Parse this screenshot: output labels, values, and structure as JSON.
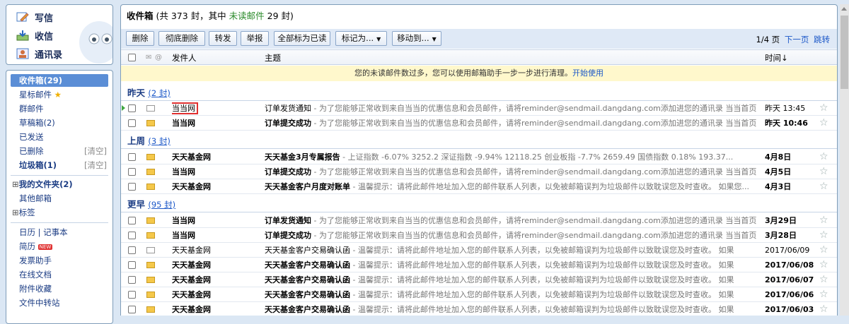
{
  "quick_actions": {
    "compose": "写信",
    "receive": "收信",
    "contacts": "通讯录"
  },
  "folders": [
    {
      "label": "收件箱(29)",
      "selected": true
    },
    {
      "label": "星标邮件",
      "star": true
    },
    {
      "label": "群邮件"
    },
    {
      "label": "草稿箱(2)"
    },
    {
      "label": "已发送"
    },
    {
      "label": "已删除",
      "clear": "[清空]"
    },
    {
      "label": "垃圾箱(1)",
      "clear": "[清空]",
      "bold": true
    },
    {
      "label": "我的文件夹(2)",
      "group": true,
      "bold": true
    },
    {
      "label": "其他邮箱"
    },
    {
      "label": "标签",
      "group": true
    },
    {
      "label": "日历 | 记事本"
    },
    {
      "label": "简历",
      "badge": "NEW"
    },
    {
      "label": "发票助手"
    },
    {
      "label": "在线文档"
    },
    {
      "label": "附件收藏"
    },
    {
      "label": "文件中转站"
    }
  ],
  "header": {
    "title": "收件箱",
    "count_text": " (共 373 封，其中 ",
    "unread_text": "未读邮件",
    "unread_count": " 29 封)"
  },
  "toolbar": {
    "buttons": [
      "删除",
      "彻底删除",
      "转发",
      "举报",
      "全部标为已读",
      "标记为...",
      "移动到..."
    ],
    "pager": "1/4 页",
    "next": "下一页",
    "jump": "跳转"
  },
  "columns": {
    "from": "发件人",
    "subject": "主题",
    "time": "时间↓"
  },
  "notice": {
    "text": "您的未读邮件数过多，您可以使用邮箱助手一步一步进行清理。",
    "link": "开始使用"
  },
  "groups": [
    {
      "title": "昨天",
      "count": "(2 封)"
    },
    {
      "title": "上周",
      "count": "(3 封)"
    },
    {
      "title": "更早",
      "count": "(95 封)"
    }
  ],
  "emails": [
    {
      "from": "当当网",
      "subject": "订单发货通知",
      "preview": " - 为了您能够正常收到来自当当的优惠信息和会员邮件，请将reminder@sendmail.dangdang.com添加进您的通讯录  当当首页 | ...",
      "time": "昨天 13:45",
      "unread": false
    },
    {
      "from": "当当网",
      "subject": "订单提交成功",
      "preview": " - 为了您能够正常收到来自当当的优惠信息和会员邮件，请将reminder@sendmail.dangdang.com添加进您的通讯录  当当首页 | ...",
      "time": "昨天 10:46",
      "unread": true
    },
    {
      "from": "天天基金网",
      "subject": "天天基金3月专属报告",
      "preview": " - 上证指数  -6.07% 3252.2   深证指数  -9.94% 12118.25   创业板指  -7.7% 2659.49   国债指数  0.18% 193.37...",
      "time": "4月8日",
      "unread": true
    },
    {
      "from": "当当网",
      "subject": "订单提交成功",
      "preview": " - 为了您能够正常收到来自当当的优惠信息和会员邮件，请将reminder@sendmail.dangdang.com添加进您的通讯录  当当首页 | ...",
      "time": "4月5日",
      "unread": true
    },
    {
      "from": "天天基金网",
      "subject": "天天基金客户月度对账单",
      "preview": " - 温馨提示：请将此邮件地址加入您的邮件联系人列表，以免被邮箱误判为垃圾邮件以致耽误您及时查收。    如果您...",
      "time": "4月3日",
      "unread": true
    },
    {
      "from": "当当网",
      "subject": "订单发货通知",
      "preview": " - 为了您能够正常收到来自当当的优惠信息和会员邮件，请将reminder@sendmail.dangdang.com添加进您的通讯录  当当首页 | ...",
      "time": "3月29日",
      "unread": true
    },
    {
      "from": "当当网",
      "subject": "订单提交成功",
      "preview": " - 为了您能够正常收到来自当当的优惠信息和会员邮件，请将reminder@sendmail.dangdang.com添加进您的通讯录  当当首页 | ...",
      "time": "3月28日",
      "unread": true
    },
    {
      "from": "天天基金网",
      "subject": "天天基金客户交易确认函",
      "preview": " - 温馨提示：请将此邮件地址加入您的邮件联系人列表，以免被邮箱误判为垃圾邮件以致耽误您及时查收。  如果",
      "time": "2017/06/09",
      "unread": false
    },
    {
      "from": "天天基金网",
      "subject": "天天基金客户交易确认函",
      "preview": " - 温馨提示：请将此邮件地址加入您的邮件联系人列表，以免被邮箱误判为垃圾邮件以致耽误您及时查收。  如果",
      "time": "2017/06/08",
      "unread": true
    },
    {
      "from": "天天基金网",
      "subject": "天天基金客户交易确认函",
      "preview": " - 温馨提示：请将此邮件地址加入您的邮件联系人列表，以免被邮箱误判为垃圾邮件以致耽误您及时查收。  如果",
      "time": "2017/06/07",
      "unread": true
    },
    {
      "from": "天天基金网",
      "subject": "天天基金客户交易确认函",
      "preview": " - 温馨提示：请将此邮件地址加入您的邮件联系人列表，以免被邮箱误判为垃圾邮件以致耽误您及时查收。  如果",
      "time": "2017/06/06",
      "unread": true
    },
    {
      "from": "天天基金网",
      "subject": "天天基金客户交易确认函",
      "preview": " - 温馨提示：请将此邮件地址加入您的邮件联系人列表，以免被邮箱误判为垃圾邮件以致耽误您及时查收。  如果",
      "time": "2017/06/03",
      "unread": true
    }
  ],
  "colors": {
    "accent": "#5b8ed6",
    "unread_env": "#f5c84a",
    "highlight": "#e03030"
  }
}
